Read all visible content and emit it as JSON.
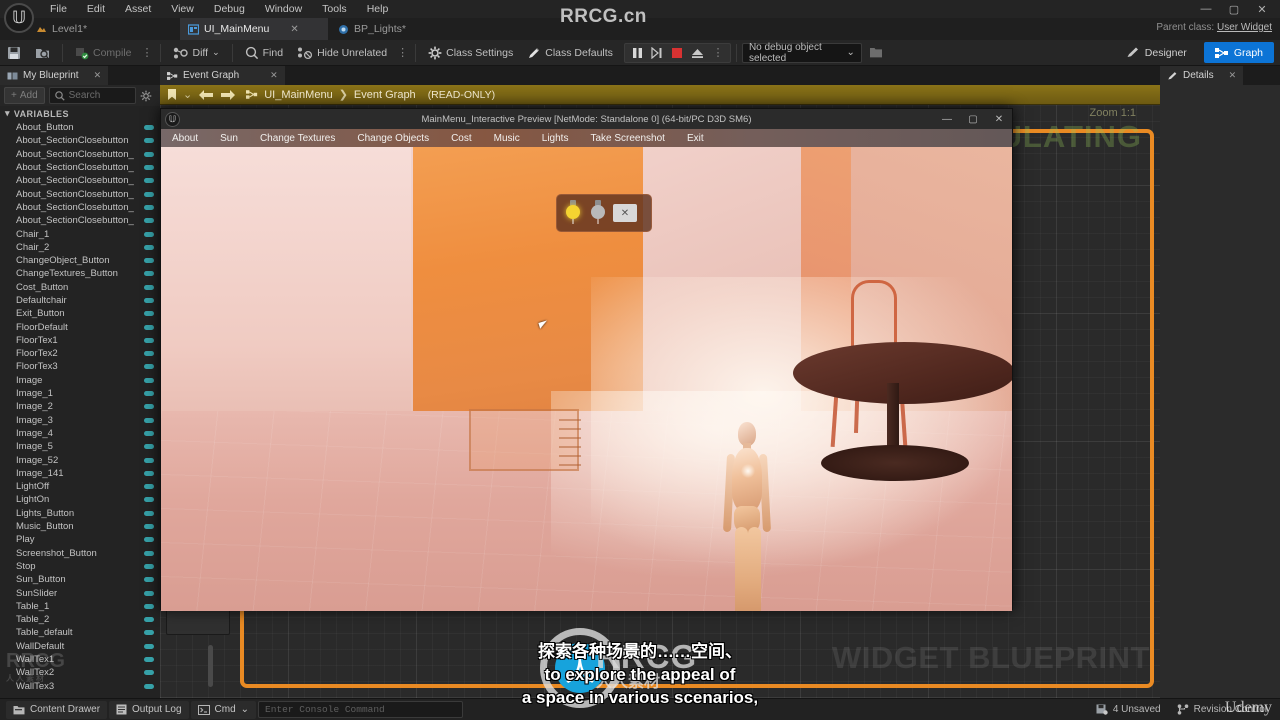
{
  "app": {
    "brand": "Unreal Engine",
    "watermark_top": "RRCG.cn",
    "watermark_simulating": "SIMULATING",
    "watermark_zoom": "Zoom 1:1",
    "watermark_widget": "WIDGET BLUEPRINT",
    "watermark_rrcg_big": "RRCG",
    "watermark_rrcg_cn": "人人素材",
    "watermark_rrcg_small": "RRCG",
    "watermark_rrcg_small_sub": "人人素材",
    "watermark_udemy": "Udemy",
    "watermark_canvas_rrcg": "RRCG"
  },
  "menubar": {
    "items": [
      "File",
      "Edit",
      "Asset",
      "View",
      "Debug",
      "Window",
      "Tools",
      "Help"
    ],
    "window_controls": [
      "—",
      "▢",
      "✕"
    ]
  },
  "tabs": [
    {
      "label": "Level1*",
      "icon": "level-icon",
      "active": false
    },
    {
      "label": "UI_MainMenu",
      "icon": "widget-blueprint-icon",
      "active": true,
      "close": "✕"
    },
    {
      "label": "BP_Lights*",
      "icon": "blueprint-icon",
      "active": false
    }
  ],
  "parent_class": {
    "label": "Parent class:",
    "value": "User Widget"
  },
  "toolbar": {
    "save_icon": "save-icon",
    "browse_icon": "browse-content-icon",
    "compile_label": "Compile",
    "compile_icon": "compile-icon",
    "diff_label": "Diff",
    "diff_icon": "diff-icon",
    "find_label": "Find",
    "find_icon": "search-icon",
    "hide_unrelated_label": "Hide Unrelated",
    "hide_unrelated_icon": "hide-unrelated-icon",
    "class_settings_label": "Class Settings",
    "class_settings_icon": "gear-icon",
    "class_defaults_label": "Class Defaults",
    "class_defaults_icon": "pencil-icon",
    "sim_pause_icon": "pause-icon",
    "sim_frameskip_icon": "frame-skip-icon",
    "sim_stop_icon": "stop-icon",
    "sim_eject_icon": "eject-icon",
    "debug_object_label": "No debug object selected",
    "debug_object_chevron": "⌄",
    "debug_filter_icon": "debug-filter-icon",
    "designer_label": "Designer",
    "graph_label": "Graph"
  },
  "left_panel": {
    "tab_label": "My Blueprint",
    "tab_icon": "blueprint-panel-icon",
    "tab_close": "✕",
    "add_label": "Add",
    "add_icon": "plus-icon",
    "search_placeholder": "Search",
    "search_icon": "search-icon",
    "settings_icon": "gear-icon",
    "section_label": "VARIABLES",
    "section_chevron": "▾",
    "variables": [
      "About_Button",
      "About_SectionClosebutton",
      "About_SectionClosebutton_",
      "About_SectionClosebutton_",
      "About_SectionClosebutton_",
      "About_SectionClosebutton_",
      "About_SectionClosebutton_",
      "About_SectionClosebutton_",
      "Chair_1",
      "Chair_2",
      "ChangeObject_Button",
      "ChangeTextures_Button",
      "Cost_Button",
      "Defaultchair",
      "Exit_Button",
      "FloorDefault",
      "FloorTex1",
      "FloorTex2",
      "FloorTex3",
      "Image",
      "Image_1",
      "Image_2",
      "Image_3",
      "Image_4",
      "Image_5",
      "Image_52",
      "Image_141",
      "LightOff",
      "LightOn",
      "Lights_Button",
      "Music_Button",
      "Play",
      "Screenshot_Button",
      "Stop",
      "Sun_Button",
      "SunSlider",
      "Table_1",
      "Table_2",
      "Table_default",
      "WallDefault",
      "WallTex1",
      "WallTex2",
      "WallTex3"
    ]
  },
  "graph_panel": {
    "tab_label": "Event Graph",
    "tab_icon": "event-graph-icon",
    "tab_close": "✕",
    "breadcrumb": {
      "home_icon": "bookmark-icon",
      "home_chevron": "⌄",
      "back_icon": "arrow-left-icon",
      "forward_icon": "arrow-right-icon",
      "graph_icon": "event-graph-icon",
      "root": "UI_MainMenu",
      "separator": "❯",
      "leaf": "Event Graph",
      "readonly": "(READ-ONLY)"
    }
  },
  "right_panel": {
    "tab_label": "Details",
    "tab_icon": "details-icon",
    "tab_close": "✕"
  },
  "preview_window": {
    "title": "MainMenu_Interactive Preview [NetMode: Standalone 0]  (64-bit/PC D3D SM6)",
    "logo_icon": "unreal-logo-icon",
    "window_controls": [
      "—",
      "▢",
      "✕"
    ],
    "menu_items": [
      "About",
      "Sun",
      "Change Textures",
      "Change Objects",
      "Cost",
      "Music",
      "Lights",
      "Take Screenshot",
      "Exit"
    ],
    "light_popup": {
      "bulb_on_icon": "light-bulb-on-icon",
      "bulb_off_icon": "light-bulb-off-icon",
      "close_label": "✕"
    }
  },
  "subtitles": [
    "探索各种场景的……空间、",
    "to explore the appeal of",
    "a space in various scenarios,"
  ],
  "status_bar": {
    "content_drawer_label": "Content Drawer",
    "content_drawer_icon": "content-drawer-icon",
    "output_log_label": "Output Log",
    "output_log_icon": "output-log-icon",
    "cmd_label": "Cmd",
    "cmd_icon": "cmd-icon",
    "cmd_chevron": "⌄",
    "console_placeholder": "Enter Console Command",
    "unsaved_label": "4 Unsaved",
    "unsaved_icon": "unsaved-icon",
    "revision_label": "Revision Control",
    "revision_icon": "revision-control-icon"
  },
  "colors": {
    "accent_blue": "#0c74d6",
    "sim_border_orange": "#e98a23",
    "breadcrumb_gold": "#8a7318",
    "pin_teal": "#36a1a8",
    "stop_red": "#d83232"
  }
}
